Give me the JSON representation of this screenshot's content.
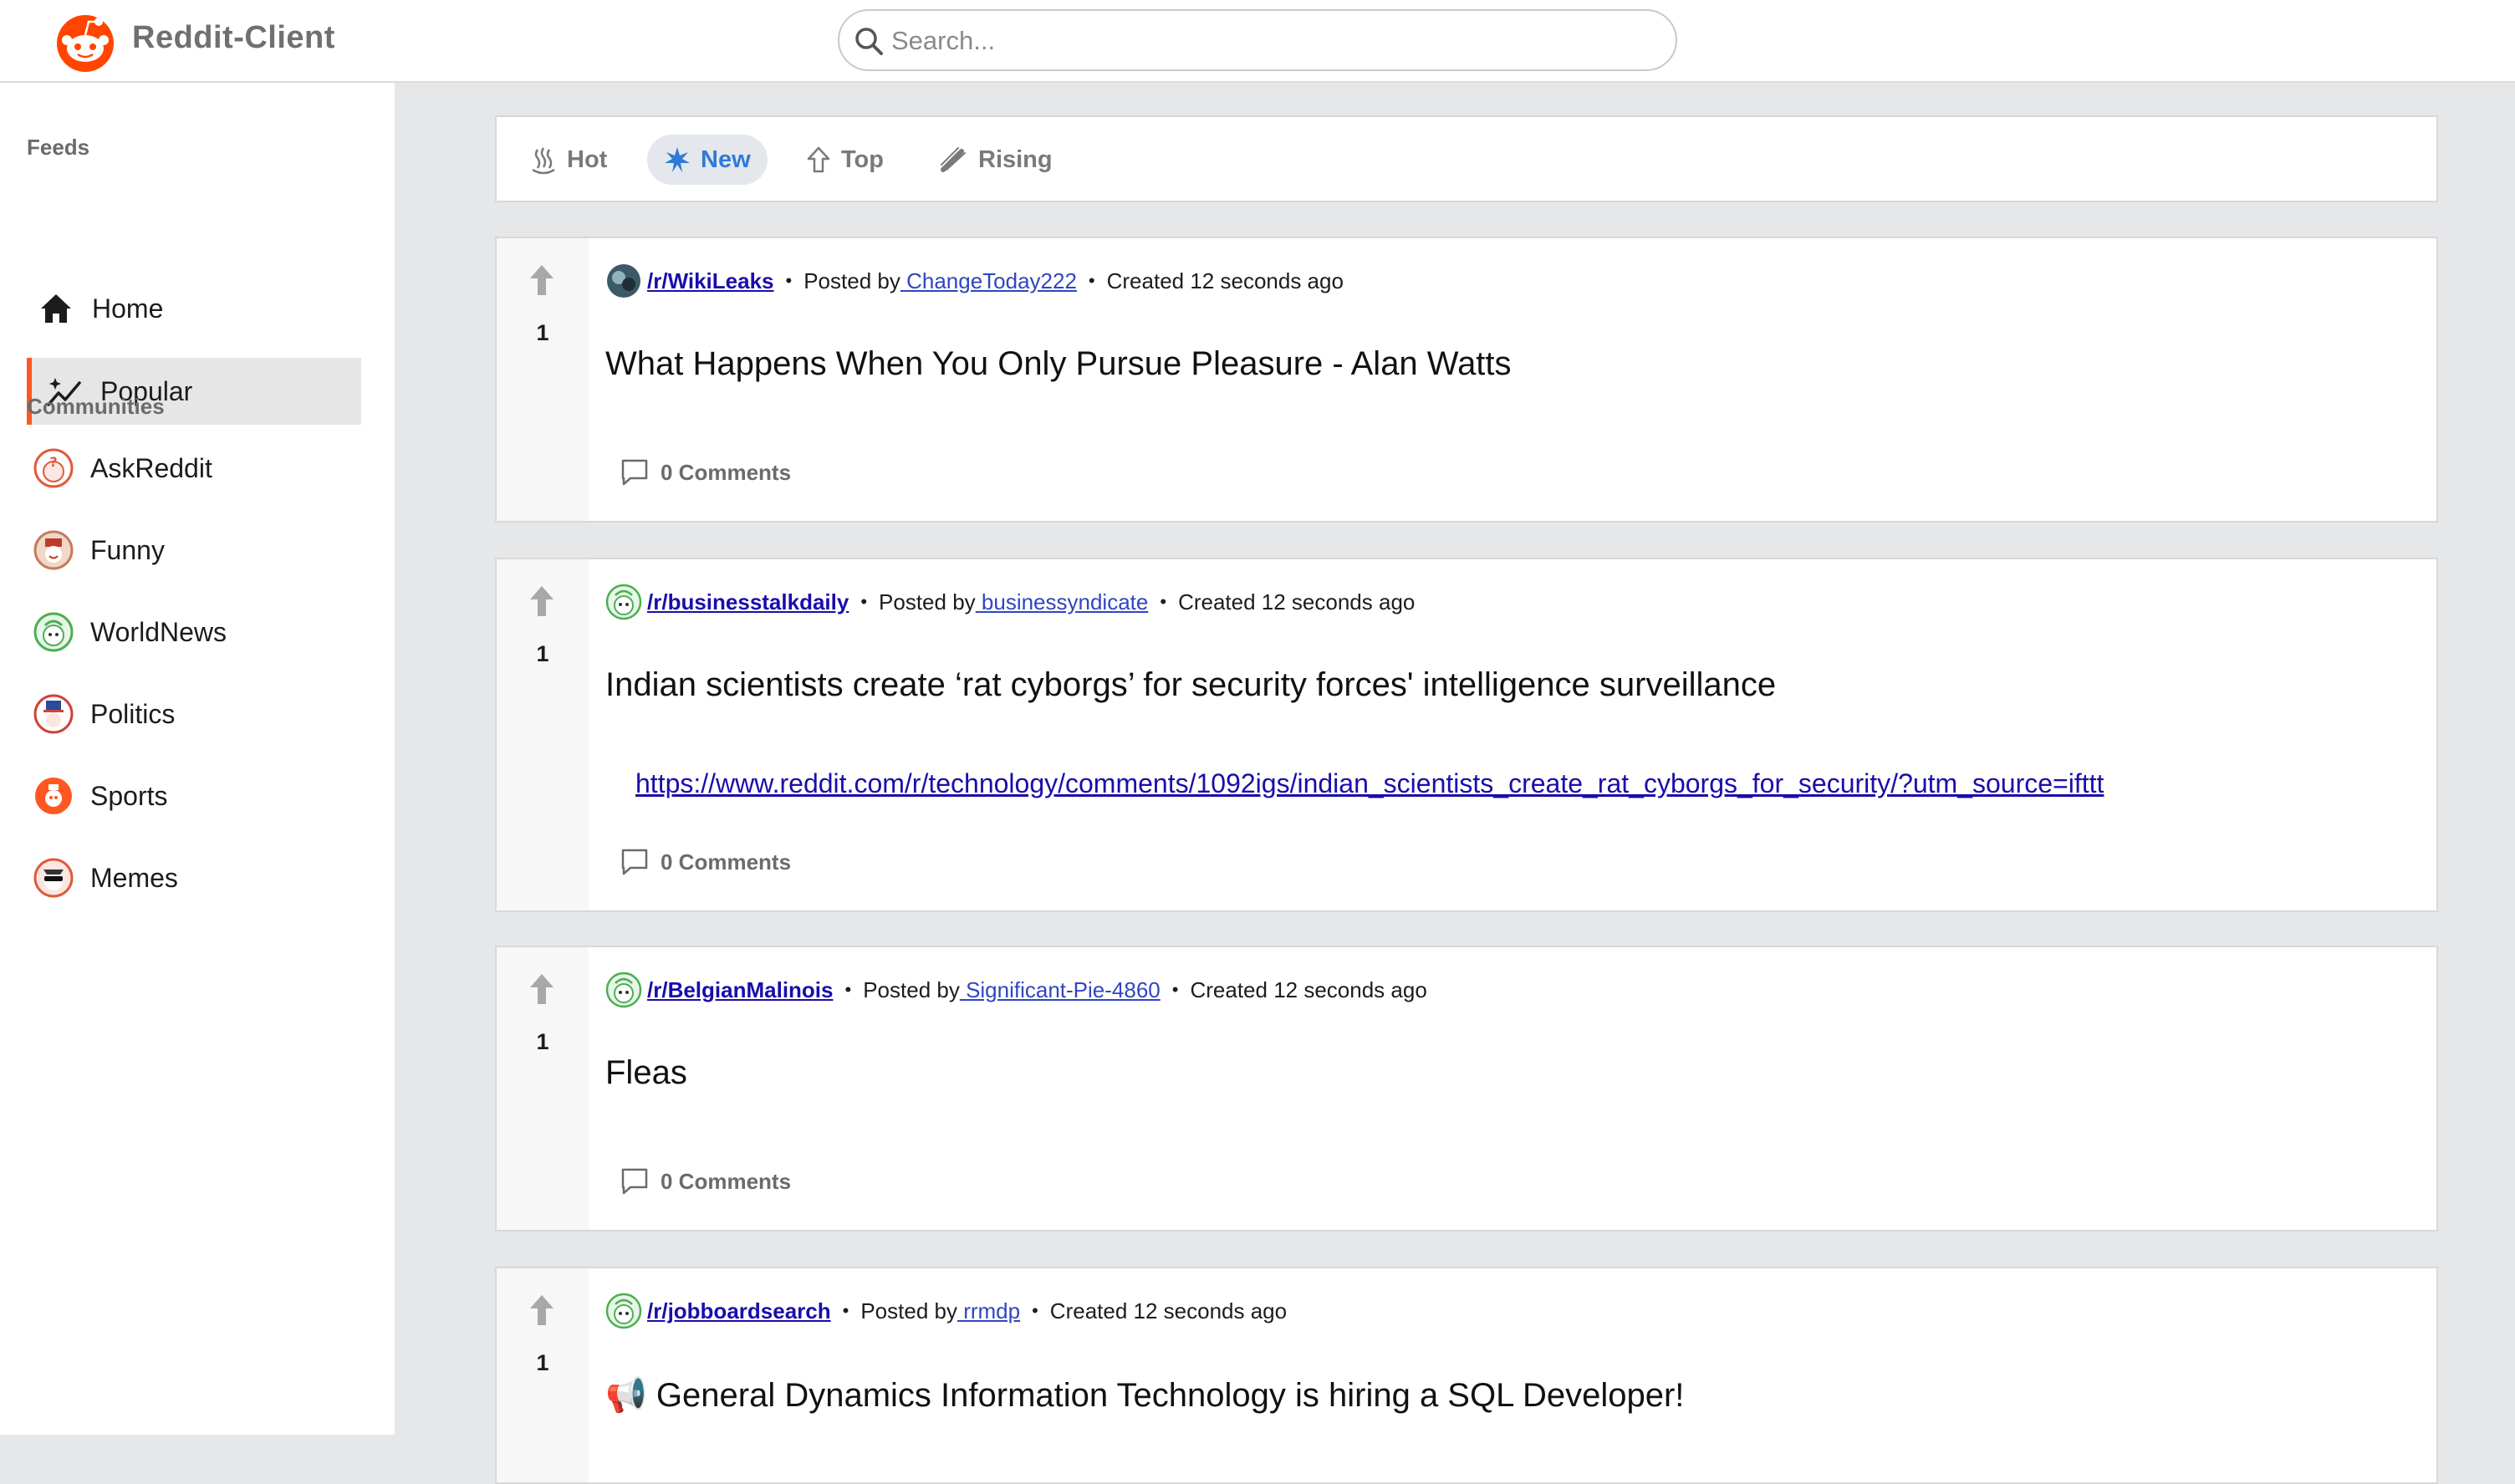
{
  "header": {
    "app_title": "Reddit-Client",
    "search_placeholder": "Search..."
  },
  "sidebar": {
    "feeds_label": "Feeds",
    "feeds": [
      {
        "label": "Home",
        "icon": "home-icon"
      },
      {
        "label": "Popular",
        "icon": "trending-icon",
        "active": true
      }
    ],
    "communities_label": "Communities",
    "communities": [
      {
        "label": "AskReddit",
        "icon": "askreddit-icon"
      },
      {
        "label": "Funny",
        "icon": "funny-icon"
      },
      {
        "label": "WorldNews",
        "icon": "worldnews-icon"
      },
      {
        "label": "Politics",
        "icon": "politics-icon"
      },
      {
        "label": "Sports",
        "icon": "sports-icon"
      },
      {
        "label": "Memes",
        "icon": "memes-icon"
      }
    ]
  },
  "sort_tabs": [
    {
      "label": "Hot",
      "icon": "hot-icon"
    },
    {
      "label": "New",
      "icon": "new-icon",
      "active": true
    },
    {
      "label": "Top",
      "icon": "top-icon"
    },
    {
      "label": "Rising",
      "icon": "rising-icon"
    }
  ],
  "posts": [
    {
      "score": "1",
      "subreddit": "/r/WikiLeaks",
      "posted_by_label": "Posted by",
      "author": " ChangeToday222",
      "created": "Created 12 seconds ago",
      "title": "What Happens When You Only Pursue Pleasure - Alan Watts",
      "link": "",
      "comments": "0 Comments"
    },
    {
      "score": "1",
      "subreddit": "/r/businesstalkdaily",
      "posted_by_label": "Posted by",
      "author": " businessyndicate",
      "created": "Created 12 seconds ago",
      "title": "Indian scientists create ‘rat cyborgs’ for security forces' intelligence surveillance",
      "link": "https://www.reddit.com/r/technology/comments/1092igs/indian_scientists_create_rat_cyborgs_for_security/?utm_source=ifttt",
      "comments": "0 Comments"
    },
    {
      "score": "1",
      "subreddit": "/r/BelgianMalinois",
      "posted_by_label": "Posted by",
      "author": " Significant-Pie-4860",
      "created": "Created 12 seconds ago",
      "title": "Fleas",
      "link": "",
      "comments": "0 Comments"
    },
    {
      "score": "1",
      "subreddit": "/r/jobboardsearch",
      "posted_by_label": "Posted by",
      "author": " rrmdp",
      "created": "Created 12 seconds ago",
      "title": "📢 General Dynamics Information Technology is hiring a SQL Developer!",
      "link": "",
      "comments": ""
    }
  ],
  "meta_separator": "•",
  "colors": {
    "accent": "#ff5722",
    "active_tab_text": "#2f7ad8",
    "link": "#1a0dab"
  }
}
